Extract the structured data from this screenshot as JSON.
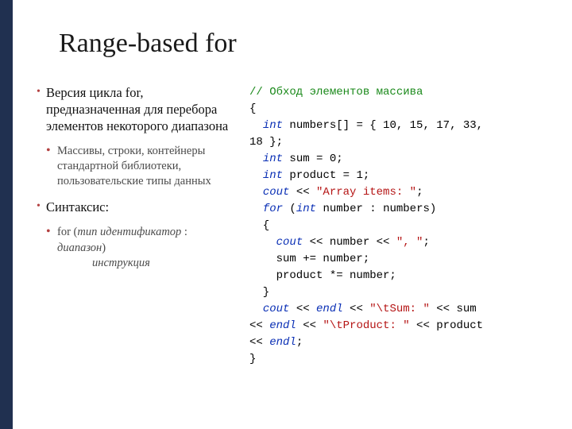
{
  "title": "Range-based for",
  "left": {
    "p1": "Версия цикла for, предназначенная для перебора элементов некоторого диапазона",
    "p2": "Массивы, строки, контейнеры стандартной библиотеки, пользовательские типы данных",
    "p3": "Синтаксис:",
    "syntax": {
      "for_kw": "for (",
      "type": "тип",
      "sp1": " ",
      "ident": "идентификатор",
      "colon": " : ",
      "range": "диапазон",
      "close": ")",
      "instr": "инструкция"
    }
  },
  "code": {
    "l1_comment": "// Обход элементов массива",
    "l2": "{",
    "l3_indent": "  ",
    "l3_int": "int",
    "l3_rest": " numbers[] = { 10, 15, 17, 33, ",
    "l4": "18 };",
    "l5_indent": "  ",
    "l5_int": "int",
    "l5_rest": " sum = 0;",
    "l6_indent": "  ",
    "l6_int": "int",
    "l6_rest": " product = 1;",
    "l7_indent": "  ",
    "l7_cout": "cout",
    "l7_op": " << ",
    "l7_str": "\"Array items: \"",
    "l7_semi": ";",
    "l8_indent": "  ",
    "l8_for": "for",
    "l8_open": " (",
    "l8_int": "int",
    "l8_rest": " number : numbers)",
    "l9": "  {",
    "l10_indent": "    ",
    "l10_cout": "cout",
    "l10_op1": " << number << ",
    "l10_str": "\", \"",
    "l10_semi": ";",
    "l11": "    sum += number;",
    "l12": "    product *= number;",
    "l13": "  }",
    "l14_indent": "  ",
    "l14_cout": "cout",
    "l14_op1": " << ",
    "l14_endl1": "endl",
    "l14_op2": " << ",
    "l14_str": "\"\\tSum: \"",
    "l14_op3": " << sum ",
    "l15_op1": "<< ",
    "l15_endl": "endl",
    "l15_op2": " << ",
    "l15_str": "\"\\tProduct: \"",
    "l15_op3": " << product ",
    "l16_op": "<< ",
    "l16_endl": "endl",
    "l16_semi": ";",
    "l17": "}"
  }
}
